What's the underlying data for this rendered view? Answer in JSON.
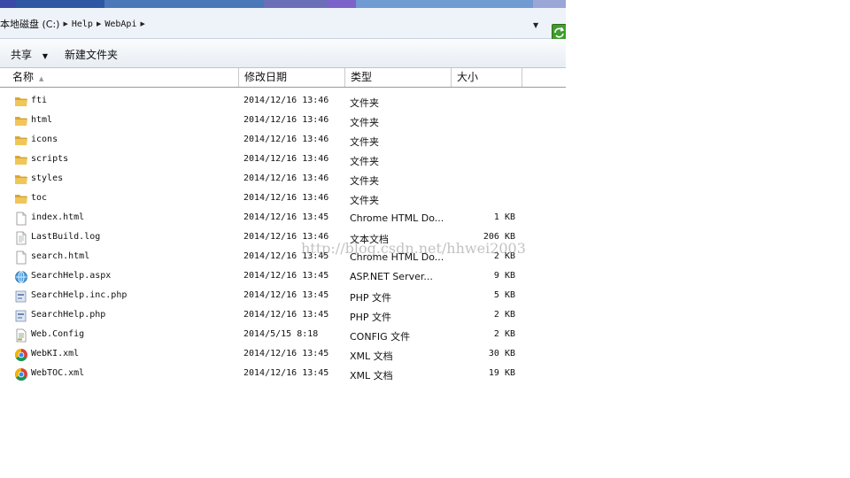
{
  "address": {
    "crumbs": [
      "本地磁盘 (C:)",
      "Help",
      "WebApi"
    ]
  },
  "toolbar": {
    "share_label": "共享",
    "new_folder_label": "新建文件夹"
  },
  "columns": {
    "name": "名称",
    "date": "修改日期",
    "type": "类型",
    "size": "大小"
  },
  "files": [
    {
      "name": "fti",
      "date": "2014/12/16 13:46",
      "type": "文件夹",
      "size": "",
      "icon": "folder-icon"
    },
    {
      "name": "html",
      "date": "2014/12/16 13:46",
      "type": "文件夹",
      "size": "",
      "icon": "folder-icon"
    },
    {
      "name": "icons",
      "date": "2014/12/16 13:46",
      "type": "文件夹",
      "size": "",
      "icon": "folder-icon"
    },
    {
      "name": "scripts",
      "date": "2014/12/16 13:46",
      "type": "文件夹",
      "size": "",
      "icon": "folder-icon"
    },
    {
      "name": "styles",
      "date": "2014/12/16 13:46",
      "type": "文件夹",
      "size": "",
      "icon": "folder-icon"
    },
    {
      "name": "toc",
      "date": "2014/12/16 13:46",
      "type": "文件夹",
      "size": "",
      "icon": "folder-icon"
    },
    {
      "name": "index.html",
      "date": "2014/12/16 13:45",
      "type": "Chrome HTML Do...",
      "size": "1 KB",
      "icon": "blank-file-icon"
    },
    {
      "name": "LastBuild.log",
      "date": "2014/12/16 13:46",
      "type": "文本文档",
      "size": "206 KB",
      "icon": "text-file-icon"
    },
    {
      "name": "search.html",
      "date": "2014/12/16 13:45",
      "type": "Chrome HTML Do...",
      "size": "2 KB",
      "icon": "blank-file-icon"
    },
    {
      "name": "SearchHelp.aspx",
      "date": "2014/12/16 13:45",
      "type": "ASP.NET Server...",
      "size": "9 KB",
      "icon": "globe-icon"
    },
    {
      "name": "SearchHelp.inc.php",
      "date": "2014/12/16 13:45",
      "type": "PHP 文件",
      "size": "5 KB",
      "icon": "script-file-icon"
    },
    {
      "name": "SearchHelp.php",
      "date": "2014/12/16 13:45",
      "type": "PHP 文件",
      "size": "2 KB",
      "icon": "script-file-icon"
    },
    {
      "name": "Web.Config",
      "date": "2014/5/15 8:18",
      "type": "CONFIG 文件",
      "size": "2 KB",
      "icon": "config-file-icon"
    },
    {
      "name": "WebKI.xml",
      "date": "2014/12/16 13:45",
      "type": "XML 文档",
      "size": "30 KB",
      "icon": "chrome-icon"
    },
    {
      "name": "WebTOC.xml",
      "date": "2014/12/16 13:45",
      "type": "XML 文档",
      "size": "19 KB",
      "icon": "chrome-icon"
    }
  ],
  "watermark": "http://blog.csdn.net/hhwei2003",
  "colors": {
    "folder": "#e8b84a",
    "toolbar_bg": "#eef3f9",
    "refresh": "#3f9d2d"
  }
}
